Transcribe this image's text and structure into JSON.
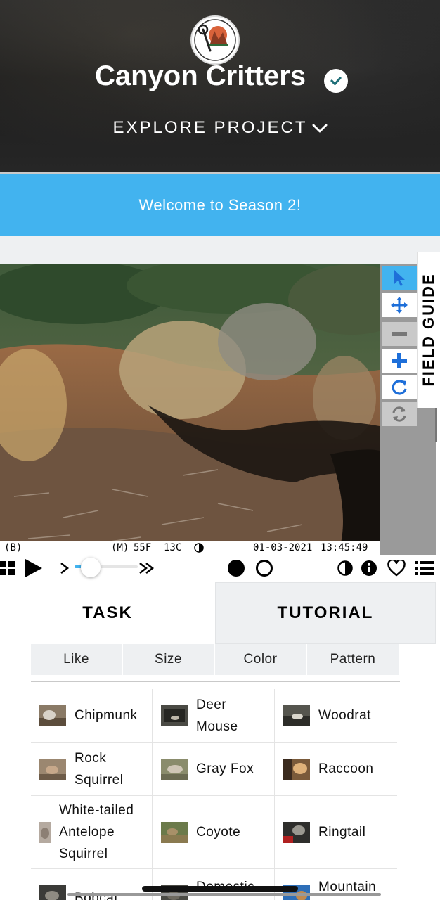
{
  "header": {
    "title": "Canyon Critters",
    "explore_label": "EXPLORE PROJECT",
    "logo_text": "CANYON CRITTERS"
  },
  "announcement": {
    "text": "Welcome to Season 2!"
  },
  "field_guide": {
    "label": "FIELD GUIDE"
  },
  "camera_info": {
    "mode_b": "B",
    "mode_m": "M",
    "temp_f": "55F",
    "temp_c": "13C",
    "date": "01-03-2021",
    "time": "13:45:49"
  },
  "playback": {
    "speed_fraction": 0.25
  },
  "tabs": {
    "task": "TASK",
    "tutorial": "TUTORIAL"
  },
  "filters": [
    "Like",
    "Size",
    "Color",
    "Pattern"
  ],
  "choices": [
    [
      "Chipmunk"
    ],
    [
      "Deer",
      "Mouse"
    ],
    [
      "Woodrat"
    ],
    [
      "Rock",
      "Squirrel"
    ],
    [
      "Gray Fox"
    ],
    [
      "Raccoon"
    ],
    [
      "White-tailed",
      "Antelope",
      "Squirrel"
    ],
    [
      "Coyote"
    ],
    [
      "Ringtail"
    ],
    [
      "Bobcat"
    ],
    [
      "Domestic"
    ],
    [
      "Mountain"
    ]
  ],
  "colors": {
    "accent": "#42b3ef",
    "tab_inactive": "#eef0f2"
  }
}
